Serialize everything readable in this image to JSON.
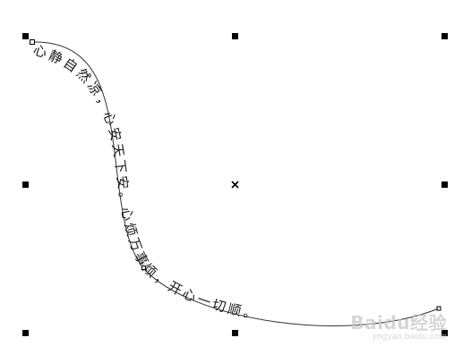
{
  "canvas": {
    "path_text": "心静自然凉，心安天下安。心烦万事烦，开心一切顺。",
    "text_color": "#1a1a1a",
    "curve_color": "#333333",
    "handle_color": "#000000",
    "background_color": "#ffffff"
  },
  "watermark": {
    "brand": "Baidu经验",
    "site": "jingyan.baidu.com",
    "color": "#c8c8c8"
  }
}
